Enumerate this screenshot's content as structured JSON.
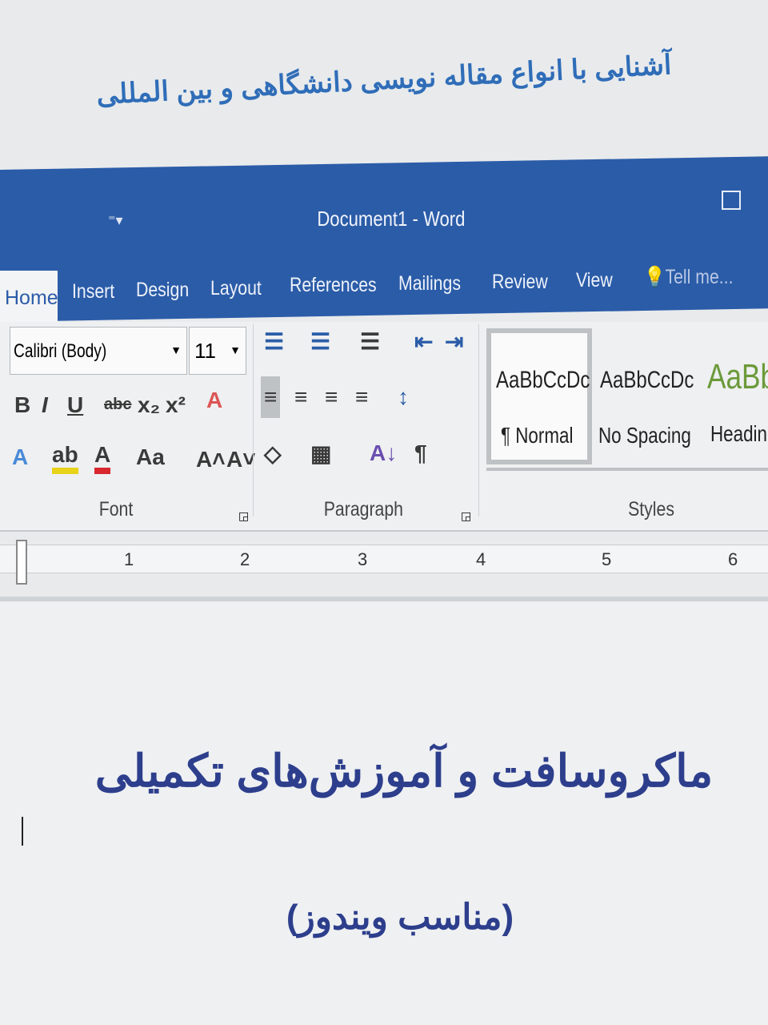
{
  "cover": {
    "top_title": "آشنایی با انواع مقاله نویسی دانشگاهی و بین المللی",
    "main_title": "ماکروسافت و آموزش‌های تکمیلی",
    "subtitle": "(مناسب ویندوز)"
  },
  "window": {
    "title": "Document1 - Word"
  },
  "tabs": [
    "Home",
    "Insert",
    "Design",
    "Layout",
    "References",
    "Mailings",
    "Review",
    "View",
    "Tell me..."
  ],
  "font": {
    "name": "Calibri (Body)",
    "size": "11",
    "group_label": "Font"
  },
  "paragraph": {
    "group_label": "Paragraph"
  },
  "styles": {
    "group_label": "Styles",
    "items": [
      {
        "preview": "AaBbCcDc",
        "label": "¶ Normal"
      },
      {
        "preview": "AaBbCcDc",
        "label": "No Spacing"
      },
      {
        "preview": "AaBb",
        "label": "Heading"
      }
    ]
  },
  "ruler": [
    "1",
    "2",
    "3",
    "4",
    "5",
    "6"
  ],
  "colors": {
    "accent": "#2b5ca8",
    "title_text": "#2f6db8",
    "cover_text": "#2d3e8c",
    "heading_green": "#6b9a3a"
  }
}
